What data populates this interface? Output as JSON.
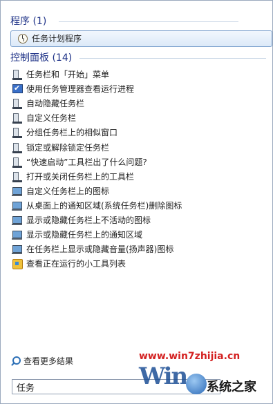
{
  "programs": {
    "header": "程序 (1)",
    "items": [
      {
        "label": "任务计划程序",
        "icon": "clock-icon"
      }
    ]
  },
  "control_panel": {
    "header": "控制面板 (14)",
    "items": [
      {
        "label": "任务栏和「开始」菜单",
        "icon": "taskbar-icon"
      },
      {
        "label": "使用任务管理器查看运行进程",
        "icon": "task-manager-icon"
      },
      {
        "label": "自动隐藏任务栏",
        "icon": "taskbar-icon"
      },
      {
        "label": "自定义任务栏",
        "icon": "taskbar-icon"
      },
      {
        "label": "分组任务栏上的相似窗口",
        "icon": "taskbar-icon"
      },
      {
        "label": "锁定或解除锁定任务栏",
        "icon": "taskbar-icon"
      },
      {
        "label": "“快速启动”工具栏出了什么问题?",
        "icon": "taskbar-icon"
      },
      {
        "label": "打开或关闭任务栏上的工具栏",
        "icon": "taskbar-icon"
      },
      {
        "label": "自定义任务栏上的图标",
        "icon": "monitor-icon"
      },
      {
        "label": "从桌面上的通知区域(系统任务栏)删除图标",
        "icon": "monitor-icon"
      },
      {
        "label": "显示或隐藏任务栏上不活动的图标",
        "icon": "monitor-icon"
      },
      {
        "label": "显示或隐藏任务栏上的通知区域",
        "icon": "monitor-icon"
      },
      {
        "label": "在任务栏上显示或隐藏音量(扬声器)图标",
        "icon": "monitor-icon"
      },
      {
        "label": "查看正在运行的小工具列表",
        "icon": "gadget-icon"
      }
    ]
  },
  "see_more": "查看更多结果",
  "search": {
    "value": "任务"
  },
  "watermark": {
    "url": "www.win7zhijia.cn",
    "logo_letters": "Win",
    "brand": "系统之家"
  },
  "colors": {
    "header": "#1e3287",
    "selection": "#dce9f8",
    "watermark_url": "#d42222"
  }
}
